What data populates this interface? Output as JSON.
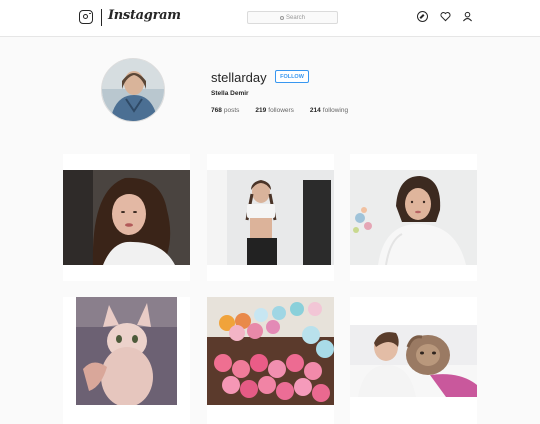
{
  "header": {
    "brand": "Instagram",
    "search_placeholder": "Search",
    "icons": [
      "camera-icon",
      "compass-icon",
      "heart-icon",
      "user-icon"
    ]
  },
  "profile": {
    "username": "stellarday",
    "follow_label": "FOLLOW",
    "full_name": "Stella Demir",
    "posts_count": "768",
    "posts_label": "posts",
    "followers_count": "219",
    "followers_label": "followers",
    "following_count": "214",
    "following_label": "following"
  },
  "colors": {
    "accent": "#3897f0",
    "background": "#fafafa",
    "text": "#262626"
  }
}
